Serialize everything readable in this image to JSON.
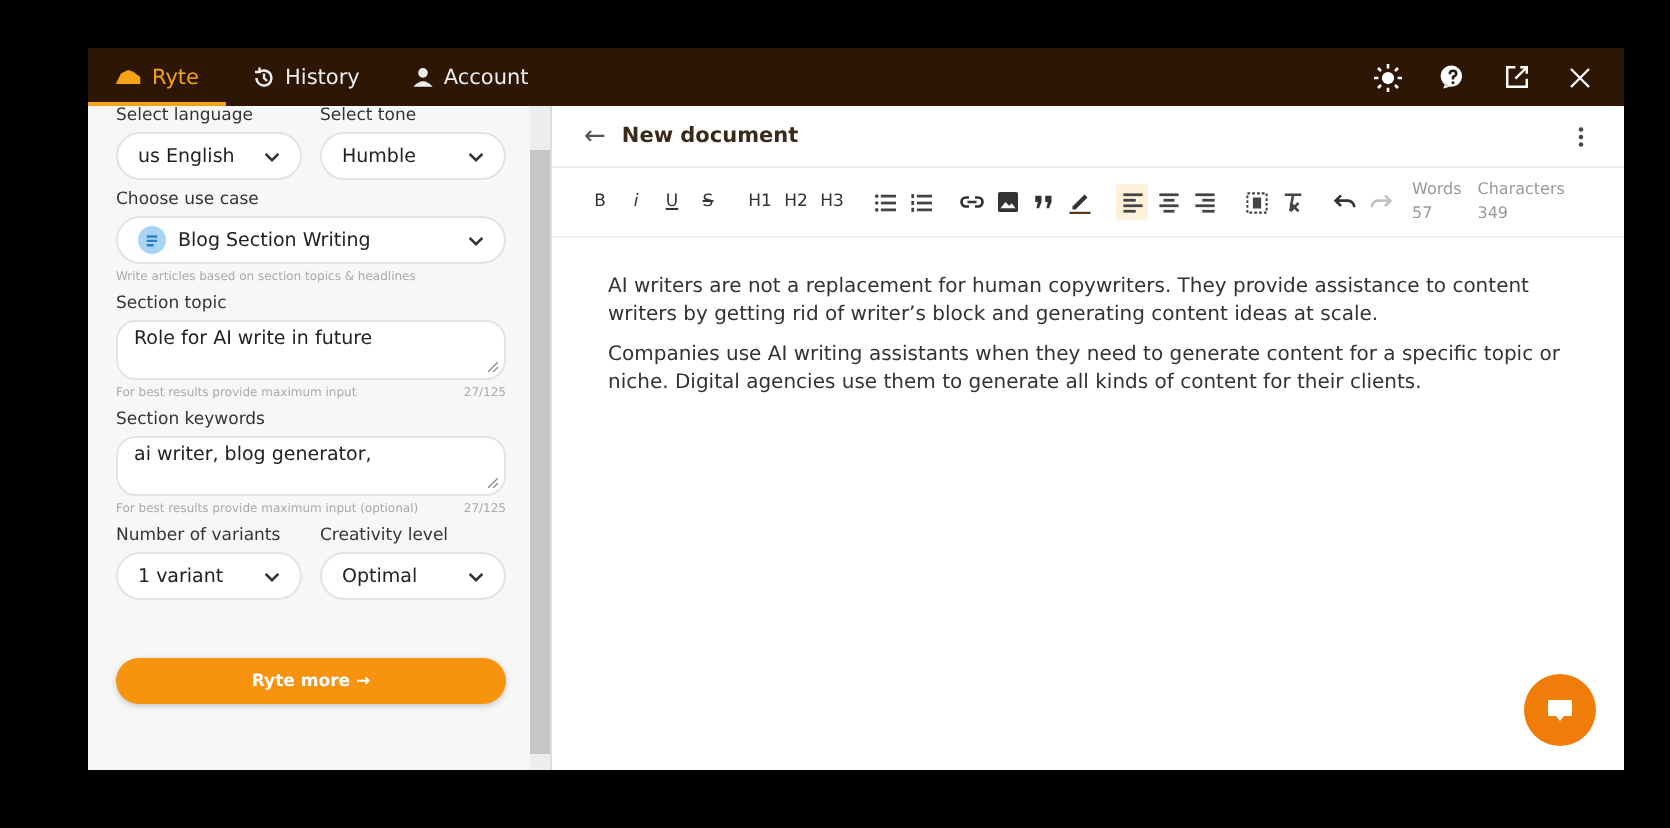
{
  "nav": {
    "tabs": [
      {
        "label": "Ryte",
        "kind": "logo",
        "selected": true
      },
      {
        "label": "History",
        "kind": "history",
        "selected": false
      },
      {
        "label": "Account",
        "kind": "account",
        "selected": false
      }
    ],
    "actions": [
      {
        "kind": "brightness"
      },
      {
        "kind": "help"
      },
      {
        "kind": "external"
      },
      {
        "kind": "close"
      }
    ]
  },
  "form": {
    "rows": [
      {
        "kind": "pair",
        "fields": [
          {
            "label": "Select language",
            "value": "us English"
          },
          {
            "label": "Select tone",
            "value": "Humble"
          }
        ]
      },
      {
        "kind": "usecase",
        "label": "Choose use case",
        "value": "Blog Section Writing",
        "hint": "Write articles based on section topics & headlines"
      },
      {
        "kind": "textarea",
        "label": "Section topic",
        "value": "Role for AI write in future",
        "hint": "For best results provide maximum input",
        "count": "27/125"
      },
      {
        "kind": "textarea",
        "label": "Section keywords",
        "value": "ai writer, blog generator,",
        "hint": "For best results provide maximum input (optional)",
        "count": "27/125"
      },
      {
        "kind": "pair",
        "fields": [
          {
            "label": "Number of variants",
            "value": "1 variant"
          },
          {
            "label": "Creativity level",
            "value": "Optimal"
          }
        ]
      }
    ],
    "submit": "Ryte more",
    "submit_arrow": "→"
  },
  "editor": {
    "title": "New document",
    "back": "←",
    "toolbar": [
      {
        "kind": "bold",
        "label": "B",
        "selected": false,
        "disabled": false
      },
      {
        "kind": "italic",
        "label": "i",
        "selected": false,
        "disabled": false
      },
      {
        "kind": "underline",
        "label": "U",
        "selected": false,
        "disabled": false
      },
      {
        "kind": "strike",
        "label": "S",
        "selected": false,
        "disabled": false
      },
      {
        "kind": "sep"
      },
      {
        "kind": "heading",
        "label": "H1",
        "selected": false,
        "disabled": false
      },
      {
        "kind": "heading",
        "label": "H2",
        "selected": false,
        "disabled": false
      },
      {
        "kind": "heading",
        "label": "H3",
        "selected": false,
        "disabled": false
      },
      {
        "kind": "sep"
      },
      {
        "kind": "bullets",
        "selected": false,
        "disabled": false
      },
      {
        "kind": "numbers",
        "selected": false,
        "disabled": false
      },
      {
        "kind": "sep"
      },
      {
        "kind": "link",
        "selected": false,
        "disabled": false
      },
      {
        "kind": "image",
        "selected": false,
        "disabled": false
      },
      {
        "kind": "quote",
        "selected": false,
        "disabled": false
      },
      {
        "kind": "pen",
        "selected": false,
        "disabled": false
      },
      {
        "kind": "sep"
      },
      {
        "kind": "align-left",
        "selected": true,
        "disabled": false
      },
      {
        "kind": "align-center",
        "selected": false,
        "disabled": false
      },
      {
        "kind": "align-right",
        "selected": false,
        "disabled": false
      },
      {
        "kind": "sep"
      },
      {
        "kind": "frame",
        "selected": false,
        "disabled": false
      },
      {
        "kind": "clear",
        "selected": false,
        "disabled": false
      },
      {
        "kind": "sep"
      },
      {
        "kind": "undo",
        "selected": false,
        "disabled": false
      },
      {
        "kind": "redo",
        "selected": false,
        "disabled": true
      }
    ],
    "stats": [
      {
        "label": "Words",
        "value": "57"
      },
      {
        "label": "Characters",
        "value": "349"
      }
    ],
    "paragraphs": [
      "AI writers are not a replacement for human copywriters. They provide assistance to content writers by getting rid of writer’s block and generating content ideas at scale.",
      "Companies use AI writing assistants when they need to generate content for a specific topic or niche. Digital agencies use them to generate all kinds of content for their clients."
    ]
  }
}
